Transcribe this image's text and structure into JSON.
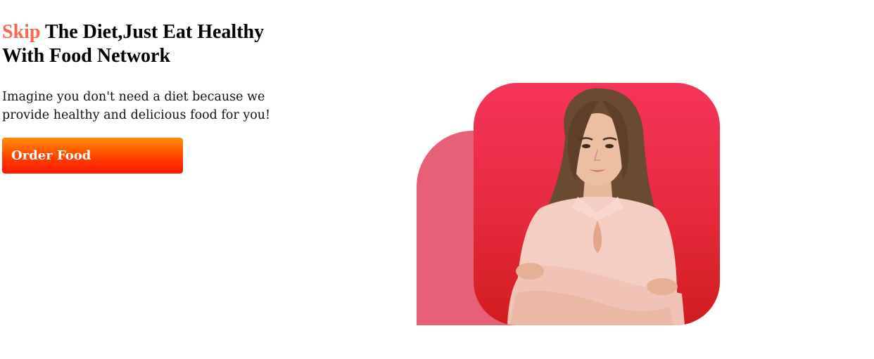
{
  "hero": {
    "headline_accent": "Skip",
    "headline_rest": " The Diet,Just Eat Healthy With Food Network",
    "subtext": "Imagine you don't need a diet because we provide healthy and delicious food for you!",
    "cta_label": "Order Food"
  },
  "colors": {
    "accent": "#f4694f",
    "card_top": "#f6345a",
    "card_bottom": "#d11c1e",
    "back_shape": "#e86078",
    "button_top": "#ff8c00",
    "button_bottom": "#ff1500"
  }
}
